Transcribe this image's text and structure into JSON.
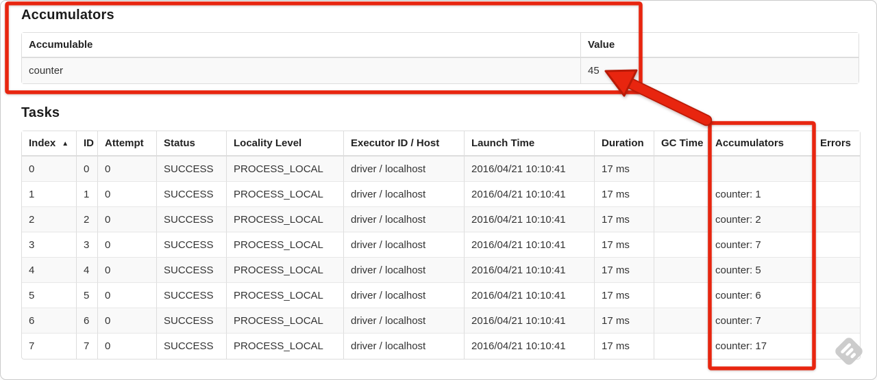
{
  "accumulators_section": {
    "title": "Accumulators",
    "table": {
      "columns": [
        "Accumulable",
        "Value"
      ],
      "rows": [
        [
          "counter",
          "45"
        ]
      ]
    }
  },
  "tasks_section": {
    "title": "Tasks",
    "table": {
      "columns": [
        "Index",
        "ID",
        "Attempt",
        "Status",
        "Locality Level",
        "Executor ID / Host",
        "Launch Time",
        "Duration",
        "GC Time",
        "Accumulators",
        "Errors"
      ],
      "sorted_column": 0,
      "sort_icon": "▲",
      "rows": [
        [
          "0",
          "0",
          "0",
          "SUCCESS",
          "PROCESS_LOCAL",
          "driver / localhost",
          "2016/04/21 10:10:41",
          "17 ms",
          "",
          "",
          ""
        ],
        [
          "1",
          "1",
          "0",
          "SUCCESS",
          "PROCESS_LOCAL",
          "driver / localhost",
          "2016/04/21 10:10:41",
          "17 ms",
          "",
          "counter: 1",
          ""
        ],
        [
          "2",
          "2",
          "0",
          "SUCCESS",
          "PROCESS_LOCAL",
          "driver / localhost",
          "2016/04/21 10:10:41",
          "17 ms",
          "",
          "counter: 2",
          ""
        ],
        [
          "3",
          "3",
          "0",
          "SUCCESS",
          "PROCESS_LOCAL",
          "driver / localhost",
          "2016/04/21 10:10:41",
          "17 ms",
          "",
          "counter: 7",
          ""
        ],
        [
          "4",
          "4",
          "0",
          "SUCCESS",
          "PROCESS_LOCAL",
          "driver / localhost",
          "2016/04/21 10:10:41",
          "17 ms",
          "",
          "counter: 5",
          ""
        ],
        [
          "5",
          "5",
          "0",
          "SUCCESS",
          "PROCESS_LOCAL",
          "driver / localhost",
          "2016/04/21 10:10:41",
          "17 ms",
          "",
          "counter: 6",
          ""
        ],
        [
          "6",
          "6",
          "0",
          "SUCCESS",
          "PROCESS_LOCAL",
          "driver / localhost",
          "2016/04/21 10:10:41",
          "17 ms",
          "",
          "counter: 7",
          ""
        ],
        [
          "7",
          "7",
          "0",
          "SUCCESS",
          "PROCESS_LOCAL",
          "driver / localhost",
          "2016/04/21 10:10:41",
          "17 ms",
          "",
          "counter: 17",
          ""
        ]
      ]
    }
  },
  "annotations": {
    "color": "#e8250f",
    "outline_color": "#b91a07"
  },
  "colors": {
    "table_border": "#dddddd",
    "striped_row": "#f9f9f9",
    "text": "#333333",
    "watermark_gray": "#cacaca"
  }
}
